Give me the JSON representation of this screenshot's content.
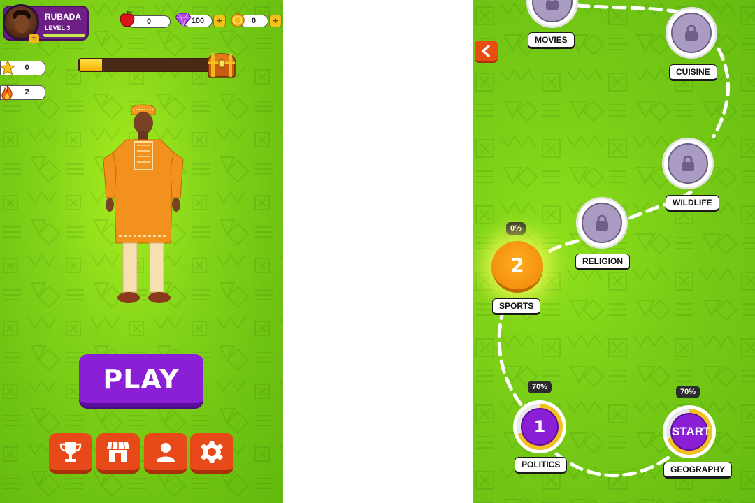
{
  "home": {
    "player": {
      "name": "RUBADA",
      "level": "LEVEL 3",
      "plus": "+"
    },
    "resources": {
      "apples": "0",
      "gems": "100",
      "coins": "0",
      "plus": "+"
    },
    "stats": {
      "stars": "0",
      "streak": "2"
    },
    "chest_progress": 0.17,
    "play_label": "PLAY",
    "menu": [
      {
        "icon": "trophy-icon"
      },
      {
        "icon": "shop-icon"
      },
      {
        "icon": "profile-icon"
      },
      {
        "icon": "settings-icon"
      }
    ]
  },
  "map": {
    "back_icon": "chevron-left-icon",
    "nodes": {
      "movies": {
        "label": "MOVIES",
        "state": "locked"
      },
      "cuisine": {
        "label": "CUISINE",
        "state": "locked"
      },
      "wildlife": {
        "label": "WILDLIFE",
        "state": "locked"
      },
      "religion": {
        "label": "RELIGION",
        "state": "locked"
      },
      "sports": {
        "label": "SPORTS",
        "number": "2",
        "percent": "0%"
      },
      "politics": {
        "label": "POLITICS",
        "number": "1",
        "percent": "70%"
      },
      "geography": {
        "label": "GEOGRAPHY",
        "text": "START",
        "percent": "70%"
      }
    }
  },
  "colors": {
    "background_green": "#84d51a",
    "play_purple": "#8a1fd6",
    "menu_orange": "#e74a18",
    "sports_orange": "#f39210",
    "progress_gold": "#f3c020"
  }
}
